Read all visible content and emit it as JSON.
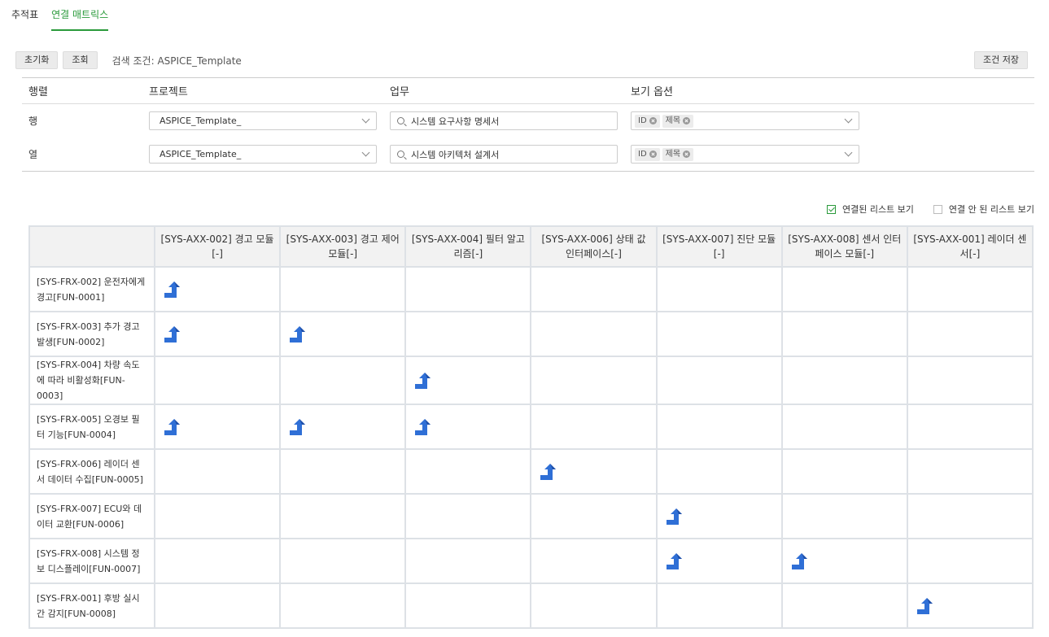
{
  "tabs": [
    {
      "label": "추적표",
      "active": false
    },
    {
      "label": "연결 매트릭스",
      "active": true
    }
  ],
  "toolbar": {
    "reset_label": "초기화",
    "search_label": "조회",
    "condition_label": "검색 조건: ASPICE_Template",
    "save_condition_label": "조건 저장"
  },
  "filter": {
    "headers": [
      "행렬",
      "프로젝트",
      "업무",
      "보기 옵션"
    ],
    "rows": [
      {
        "label": "행",
        "project": "ASPICE_Template_",
        "task": "시스템 요구사항 명세서",
        "options": [
          "ID",
          "제목"
        ]
      },
      {
        "label": "열",
        "project": "ASPICE_Template_",
        "task": "시스템 아키텍처 설계서",
        "options": [
          "ID",
          "제목"
        ]
      }
    ]
  },
  "toggles": {
    "linked_label": "연결된 리스트 보기",
    "linked_checked": true,
    "unlinked_label": "연결 안 된 리스트 보기",
    "unlinked_checked": false
  },
  "matrix": {
    "columns": [
      "[SYS-AXX-002] 경고 모듈[-]",
      "[SYS-AXX-003] 경고 제어 모듈[-]",
      "[SYS-AXX-004] 필터 알고리즘[-]",
      "[SYS-AXX-006] 상태 값 인터페이스[-]",
      "[SYS-AXX-007] 진단 모듈[-]",
      "[SYS-AXX-008] 센서 인터페이스 모듈[-]",
      "[SYS-AXX-001] 레이더 센서[-]"
    ],
    "rows": [
      {
        "label": "[SYS-FRX-002] 운전자에게 경고[FUN-0001]",
        "links": [
          1,
          0,
          0,
          0,
          0,
          0,
          0
        ]
      },
      {
        "label": "[SYS-FRX-003] 추가 경고 발생[FUN-0002]",
        "links": [
          1,
          1,
          0,
          0,
          0,
          0,
          0
        ]
      },
      {
        "label": "[SYS-FRX-004] 차량 속도에 따라 비활성화[FUN-0003]",
        "links": [
          0,
          0,
          1,
          0,
          0,
          0,
          0
        ]
      },
      {
        "label": "[SYS-FRX-005] 오경보 필터 기능[FUN-0004]",
        "links": [
          1,
          1,
          1,
          0,
          0,
          0,
          0
        ]
      },
      {
        "label": "[SYS-FRX-006] 레이더 센서 데이터 수집[FUN-0005]",
        "links": [
          0,
          0,
          0,
          1,
          0,
          0,
          0
        ]
      },
      {
        "label": "[SYS-FRX-007] ECU와 데이터 교환[FUN-0006]",
        "links": [
          0,
          0,
          0,
          0,
          1,
          0,
          0
        ]
      },
      {
        "label": "[SYS-FRX-008] 시스템 정보 디스플레이[FUN-0007]",
        "links": [
          0,
          0,
          0,
          0,
          1,
          1,
          0
        ]
      },
      {
        "label": "[SYS-FRX-001] 후방 실시간 감지[FUN-0008]",
        "links": [
          0,
          0,
          0,
          0,
          0,
          0,
          1
        ]
      }
    ],
    "link_icon": "trace-link-arrow-icon",
    "link_color": "#2f6fd6"
  },
  "colors": {
    "accent": "#2a9a3b",
    "header_bg": "#f2f2f2",
    "grid": "#dde1e6"
  }
}
